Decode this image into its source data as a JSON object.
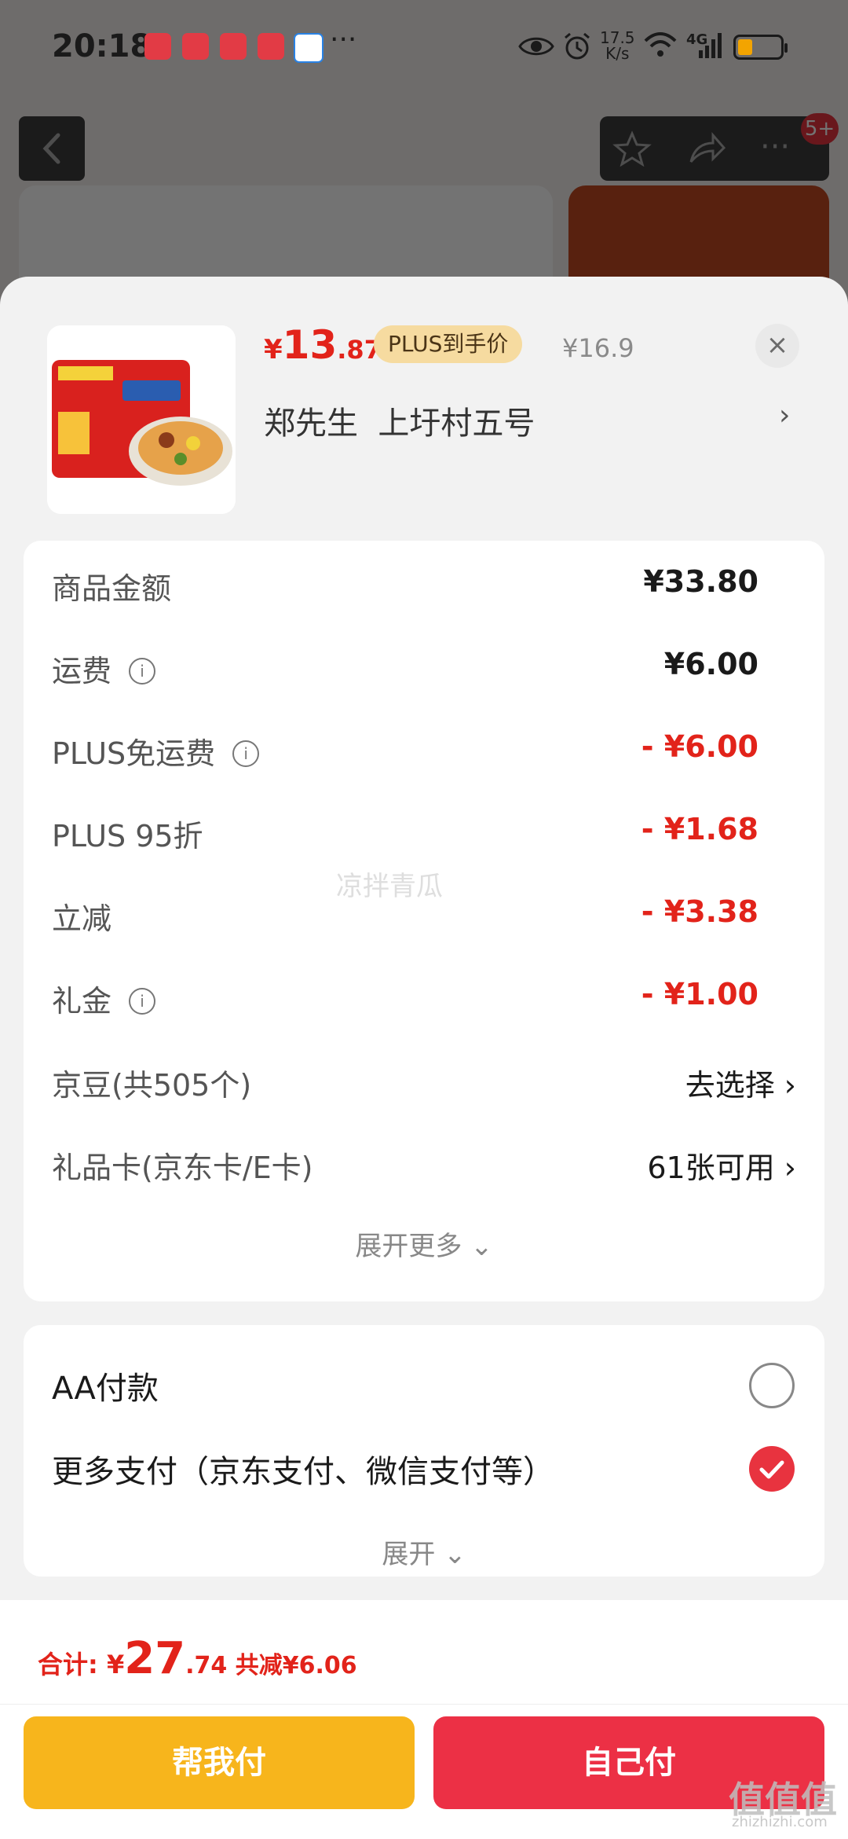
{
  "status_bar": {
    "time": "20:18",
    "more": "···",
    "network_speed": "17.5\nK/s",
    "network_type": "4G",
    "battery_level": 0.35
  },
  "background": {
    "badge": "5+"
  },
  "sheet": {
    "price": {
      "currency": "¥",
      "integer": "13",
      "decimal": ".87"
    },
    "plus_tag": "PLUS到手价",
    "original_price": "¥16.9",
    "close": "×",
    "address": "郑先生  上圩村五号",
    "address_chevron": "›",
    "fees": [
      {
        "label": "商品金额",
        "value": "¥33.80",
        "info": false,
        "red": false
      },
      {
        "label": "运费",
        "value": "¥6.00",
        "info": true,
        "red": false
      },
      {
        "label": "PLUS免运费",
        "value": "- ¥6.00",
        "info": true,
        "red": true
      },
      {
        "label": "PLUS 95折",
        "value": "- ¥1.68",
        "info": false,
        "red": true
      },
      {
        "label": "立减",
        "value": "- ¥3.38",
        "info": false,
        "red": true
      },
      {
        "label": "礼金",
        "value": "- ¥1.00",
        "info": true,
        "red": true
      }
    ],
    "jingdou": {
      "label": "京豆(共505个)",
      "value": "去选择 ›"
    },
    "gift_card": {
      "label": "礼品卡(京东卡/E卡)",
      "value": "61张可用 ›"
    },
    "expand_more": "展开更多 ⌄",
    "payment": {
      "aa": "AA付款",
      "more": "更多支付（京东支付、微信支付等）",
      "expand": "展开 ⌄",
      "selected": "more"
    }
  },
  "bottom": {
    "total_label": "合计: ¥",
    "total_int": "27",
    "total_dec": ".74",
    "saved": " 共减¥6.06",
    "help_pay": "帮我付",
    "self_pay": "自己付"
  },
  "watermarks": {
    "center": "凉拌青瓜",
    "corner": "值值值",
    "corner_sub": "zhizhizhi.com"
  },
  "colors": {
    "accent_red": "#e2231a",
    "help_button": "#f7b51c",
    "self_button": "#ec3045",
    "plus_tag_bg": "#f6dba0"
  }
}
